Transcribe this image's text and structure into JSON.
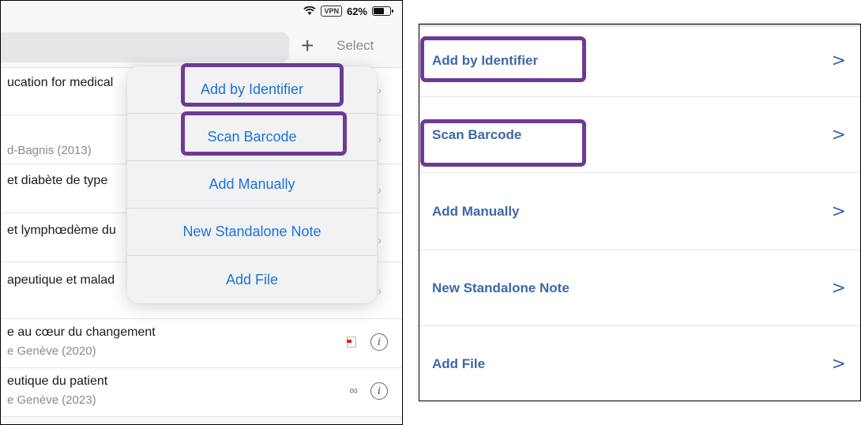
{
  "status_bar": {
    "vpn": "VPN",
    "battery": "62%"
  },
  "toolbar": {
    "plus": "+",
    "select": "Select"
  },
  "list": [
    {
      "title": "ucation for medical",
      "subtitle": ""
    },
    {
      "title": "",
      "subtitle": "d-Bagnis (2013)"
    },
    {
      "title": "et diabète de type",
      "subtitle": ""
    },
    {
      "title": "et lymphœdème du",
      "subtitle": ""
    },
    {
      "title": "apeutique et malad",
      "subtitle": ""
    },
    {
      "title": "e au cœur du changement",
      "subtitle": "e Genève  (2020)"
    },
    {
      "title": "eutique du patient",
      "subtitle": "e Genève (2023)"
    }
  ],
  "popover_menu": [
    "Add by Identifier",
    "Scan Barcode",
    "Add Manually",
    "New Standalone Note",
    "Add File"
  ],
  "right_menu": [
    "Add by Identifier",
    "Scan Barcode",
    "Add Manually",
    "New Standalone Note",
    "Add File"
  ],
  "icons": {
    "info": "i",
    "attachment": "∞",
    "chevron": ">",
    "edge_chevron": "›"
  },
  "colors": {
    "highlight": "#6e3a96",
    "ios_link": "#1a73d9",
    "android_link": "#3e67a8"
  }
}
